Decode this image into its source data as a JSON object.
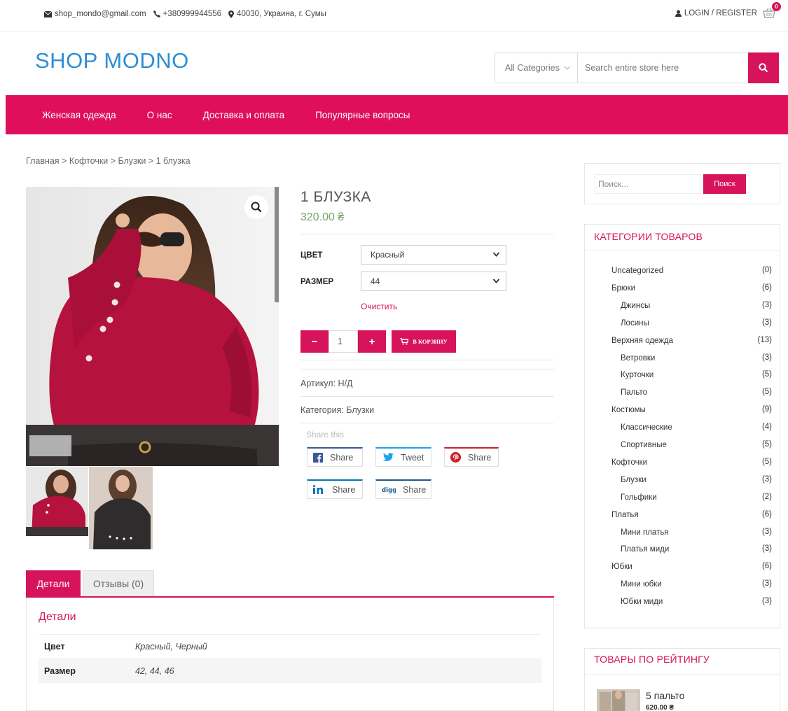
{
  "topbar": {
    "email": "shop_mondo@gmail.com",
    "phone": "+380999944556",
    "address": "40030, Украина, г. Сумы",
    "login": "LOGIN / REGISTER",
    "cart_count": "0"
  },
  "header": {
    "logo": "SHOP MODNO",
    "category_select": "All Categories",
    "search_placeholder": "Search entire store here"
  },
  "nav": {
    "items": [
      "Женская одежда",
      "О нас",
      "Доставка и оплата",
      "Популярные вопросы"
    ]
  },
  "breadcrumb": "Главная > Кофточки > Блузки > 1 блузка",
  "product": {
    "title": "1 БЛУЗКА",
    "price": "320.00 ₴",
    "color_label": "ЦВЕТ",
    "color_value": "Красный",
    "size_label": "РАЗМЕР",
    "size_value": "44",
    "clear": "Очистить",
    "quantity": "1",
    "minus": "−",
    "plus": "+",
    "add_to_cart": "В КОРЗИНУ",
    "sku": "Артикул: Н/Д",
    "category": "Категория: Блузки",
    "share_label": "Share this",
    "share_buttons": [
      {
        "icon": "facebook-icon",
        "label": "Share",
        "color": "#3b5998"
      },
      {
        "icon": "twitter-icon",
        "label": "Tweet",
        "color": "#1da1f2"
      },
      {
        "icon": "pinterest-icon",
        "label": "Share",
        "color": "#cb2027"
      },
      {
        "icon": "linkedin-icon",
        "label": "Share",
        "color": "#0077b5"
      },
      {
        "icon": "digg-icon",
        "label": "Share",
        "color": "#1b5891"
      }
    ]
  },
  "tabs": {
    "details": "Детали",
    "reviews": "Отзывы (0)",
    "panel_title": "Детали",
    "attributes": [
      {
        "name": "Цвет",
        "value": "Красный, Черный"
      },
      {
        "name": "Размер",
        "value": "42, 44, 46"
      }
    ]
  },
  "sidebar": {
    "search_placeholder": "Поиск...",
    "search_button": "Поиск",
    "categories_title": "КАТЕГОРИИ ТОВАРОВ",
    "categories": [
      {
        "name": "Uncategorized",
        "count": "(0)",
        "level": 0
      },
      {
        "name": "Брюки",
        "count": "(6)",
        "level": 0
      },
      {
        "name": "Джинсы",
        "count": "(3)",
        "level": 1
      },
      {
        "name": "Лосины",
        "count": "(3)",
        "level": 1
      },
      {
        "name": "Верхняя одежда",
        "count": "(13)",
        "level": 0
      },
      {
        "name": "Ветровки",
        "count": "(3)",
        "level": 1
      },
      {
        "name": "Курточки",
        "count": "(5)",
        "level": 1
      },
      {
        "name": "Пальто",
        "count": "(5)",
        "level": 1
      },
      {
        "name": "Костюмы",
        "count": "(9)",
        "level": 0
      },
      {
        "name": "Классические",
        "count": "(4)",
        "level": 1
      },
      {
        "name": "Спортивные",
        "count": "(5)",
        "level": 1
      },
      {
        "name": "Кофточки",
        "count": "(5)",
        "level": 0
      },
      {
        "name": "Блузки",
        "count": "(3)",
        "level": 1
      },
      {
        "name": "Гольфики",
        "count": "(2)",
        "level": 1
      },
      {
        "name": "Платья",
        "count": "(6)",
        "level": 0
      },
      {
        "name": "Мини платья",
        "count": "(3)",
        "level": 1
      },
      {
        "name": "Платья миди",
        "count": "(3)",
        "level": 1
      },
      {
        "name": "Юбки",
        "count": "(6)",
        "level": 0
      },
      {
        "name": "Мини юбки",
        "count": "(3)",
        "level": 1
      },
      {
        "name": "Юбки миди",
        "count": "(3)",
        "level": 1
      }
    ],
    "rated_title": "ТОВАРЫ ПО РЕЙТИНГУ",
    "rated_item_name": "5 пальто",
    "rated_item_price": "620.00 ₴"
  },
  "colors": {
    "accent": "#df0f5c",
    "logo": "#2b8ed6",
    "price": "#77a464"
  }
}
